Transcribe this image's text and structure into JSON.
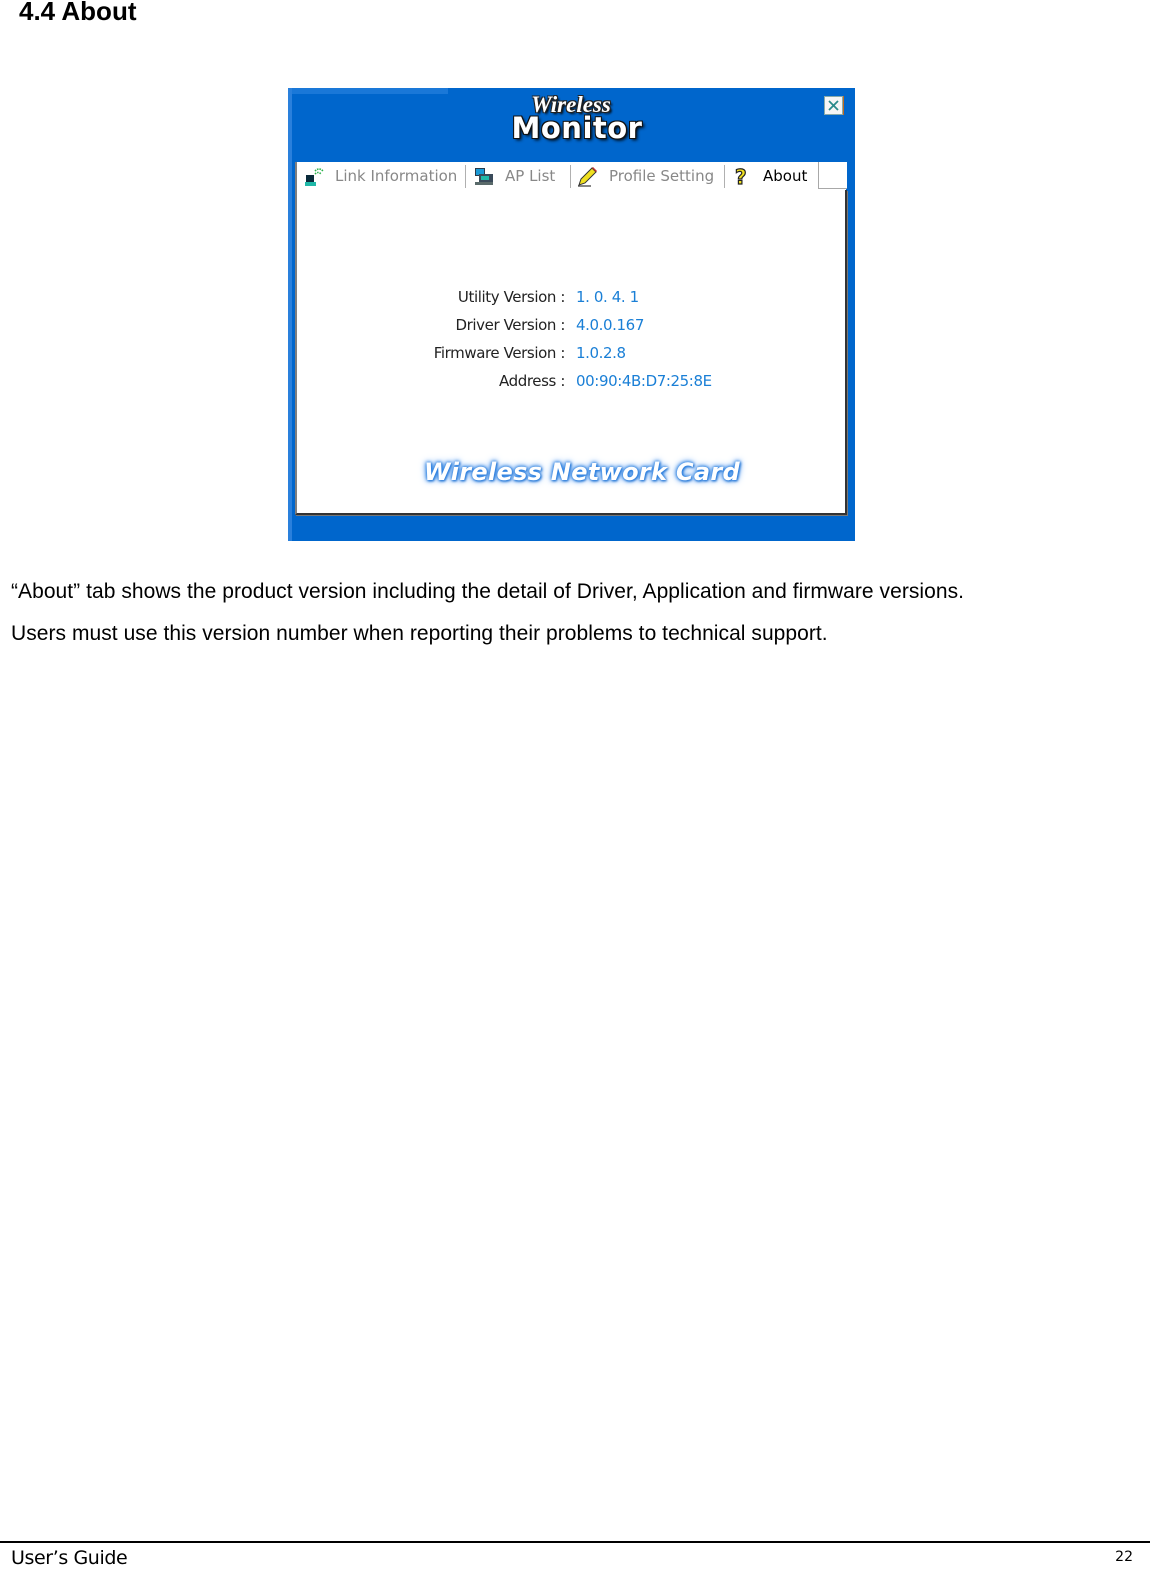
{
  "section": {
    "heading": "4.4 About"
  },
  "app": {
    "logo_line1": "Wireless",
    "logo_line2": "Monitor",
    "close_icon": "close-icon",
    "tabs": [
      {
        "label": "Link Information",
        "icon": "link-signal-icon",
        "active": false
      },
      {
        "label": "AP List",
        "icon": "computer-icon",
        "active": false
      },
      {
        "label": "Profile Setting",
        "icon": "pencil-icon",
        "active": false
      },
      {
        "label": "About",
        "icon": "question-mark-icon",
        "active": true
      }
    ],
    "info": [
      {
        "label": "Utility Version :",
        "value": "1. 0. 4. 1"
      },
      {
        "label": "Driver Version :",
        "value": "4.0.0.167"
      },
      {
        "label": "Firmware Version :",
        "value": "1.0.2.8"
      },
      {
        "label": "Address :",
        "value": "00:90:4B:D7:25:8E"
      }
    ],
    "footer_brand": "Wireless Network Card",
    "colors": {
      "window_bg": "#0066cc",
      "value_text": "#1a7fd6",
      "inactive_tab_text": "#888888"
    }
  },
  "body": {
    "paragraph_1": "“About” tab shows the product version including the detail of Driver, Application and firmware versions.",
    "paragraph_2": "Users must use this version number when reporting their problems to technical support."
  },
  "page_footer": {
    "left": "User’s Guide",
    "page_number": "22"
  }
}
